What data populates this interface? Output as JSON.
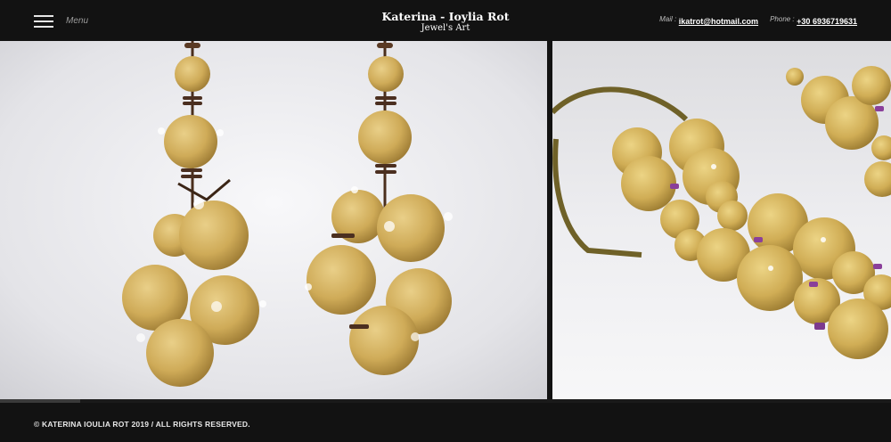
{
  "header": {
    "menu_label": "Menu",
    "brand_title": "Katerina - Ioylia Rot",
    "brand_subtitle": "Jewel's Art",
    "mail_label": "Mail :",
    "mail_value": "ikatrot@hotmail.com",
    "phone_label": "Phone :",
    "phone_value": "+30 6936719631"
  },
  "gallery": {
    "images": [
      {
        "icon": "cork-earrings-photo"
      },
      {
        "icon": "cork-necklace-photo"
      }
    ]
  },
  "footer": {
    "copyright": "© KATERINA IOULIA ROT 2019 / ALL RIGHTS RESERVED."
  },
  "colors": {
    "background": "#121212",
    "cork": "#d2b160",
    "photo_backdrop": "#ececee"
  }
}
